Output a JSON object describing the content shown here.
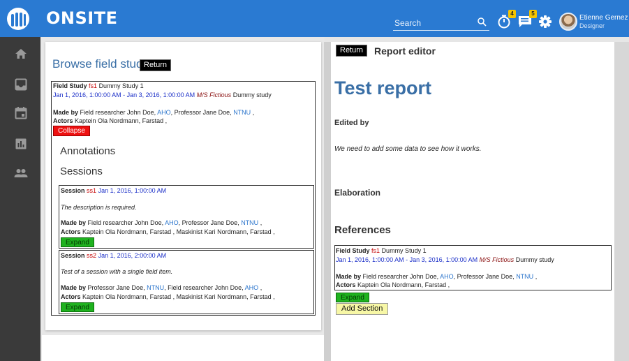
{
  "app": {
    "brand": "ONSITE"
  },
  "search": {
    "placeholder": "Search"
  },
  "toolbar": {
    "timer_badge": "4",
    "chat_badge": "5"
  },
  "user": {
    "name": "Etienne Gernez",
    "role": "Designer"
  },
  "sidebar": {
    "items": [
      "home-icon",
      "inbox-icon",
      "calendar-icon",
      "chart-icon",
      "people-icon"
    ]
  },
  "colors": {
    "topbar": "#2a7ad2",
    "sidebar": "#3a3a3a",
    "accent_blue": "#3a6fa6",
    "collapse": "#ee1111",
    "expand": "#1fb21f",
    "add_section": "#f7f7a6",
    "badge": "#f5c400"
  },
  "browse": {
    "title": "Browse field study",
    "return_label": "Return",
    "field_study": {
      "label": "Field Study",
      "id": "fs1",
      "name": "Dummy Study 1",
      "dates": "Jan 1, 2016, 1:00:00 AM - Jan 3, 2016, 1:00:00 AM",
      "vessel": "M/S Fictious",
      "desc": "Dummy study",
      "made_by_label": "Made by",
      "made_by_1": "Field researcher John Doe,",
      "made_by_1_org": "AHO",
      "made_by_2": ", Professor Jane Doe,",
      "made_by_2_org": "NTNU",
      "made_by_end": ",",
      "actors_label": "Actors",
      "actors": "Kaptein Ola Nordmann, Farstad ,",
      "collapse_label": "Collapse",
      "annotations_label": "Annotations",
      "sessions_label": "Sessions"
    },
    "sessions": [
      {
        "label": "Session",
        "id": "ss1",
        "date": "Jan 1, 2016, 1:00:00 AM",
        "desc": "The description is required.",
        "made_by_label": "Made by",
        "made_by_1": "Field researcher John Doe,",
        "made_by_1_org": "AHO",
        "made_by_2": ", Professor Jane Doe,",
        "made_by_2_org": "NTNU",
        "made_by_end": ",",
        "actors_label": "Actors",
        "actors": "Kaptein Ola Nordmann, Farstad , Maskinist Kari Nordmann, Farstad ,",
        "expand_label": "Expand"
      },
      {
        "label": "Session",
        "id": "ss2",
        "date": "Jan 1, 2016, 2:00:00 AM",
        "desc": "Test of a session with a single field item.",
        "made_by_label": "Made by",
        "made_by_1": "Professor Jane Doe,",
        "made_by_1_org": "NTNU",
        "made_by_2": ", Field researcher John Doe,",
        "made_by_2_org": "AHO",
        "made_by_end": ",",
        "actors_label": "Actors",
        "actors": "Kaptein Ola Nordmann, Farstad , Maskinist Kari Nordmann, Farstad ,",
        "expand_label": "Expand"
      }
    ]
  },
  "editor": {
    "return_label": "Return",
    "title": "Report editor",
    "report_title": "Test report",
    "edited_by_label": "Edited by",
    "note": "We need to add some data to see how it works.",
    "elaboration_label": "Elaboration",
    "references_label": "References",
    "reference": {
      "label": "Field Study",
      "id": "fs1",
      "name": "Dummy Study 1",
      "dates": "Jan 1, 2016, 1:00:00 AM - Jan 3, 2016, 1:00:00 AM",
      "vessel": "M/S Fictious",
      "desc": "Dummy study",
      "made_by_label": "Made by",
      "made_by_1": "Field researcher John Doe,",
      "made_by_1_org": "AHO",
      "made_by_2": ", Professor Jane Doe,",
      "made_by_2_org": "NTNU",
      "made_by_end": ",",
      "actors_label": "Actors",
      "actors": "Kaptein Ola Nordmann, Farstad ,"
    },
    "expand_label": "Expand",
    "add_section_label": "Add Section"
  }
}
